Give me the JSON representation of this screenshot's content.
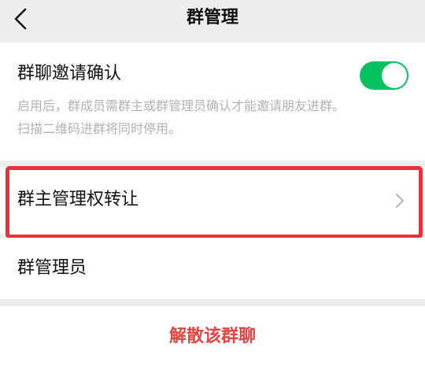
{
  "nav": {
    "title": "群管理",
    "back_icon": "chevron-left-icon"
  },
  "invite_confirm": {
    "label": "群聊邀请确认",
    "enabled": true,
    "description_line1": "启用后，群成员需群主或群管理员确认才能邀请朋友进群。",
    "description_line2": "扫描二维码进群将同时停用。"
  },
  "owner_transfer": {
    "label": "群主管理权转让",
    "icon": "chevron-right-icon"
  },
  "admins": {
    "label": "群管理员"
  },
  "dissolve": {
    "label": "解散该群聊"
  },
  "colors": {
    "accent_green": "#07c160",
    "danger_red": "#e64340",
    "highlight_red": "#ee2f3c",
    "background": "#ededed"
  }
}
